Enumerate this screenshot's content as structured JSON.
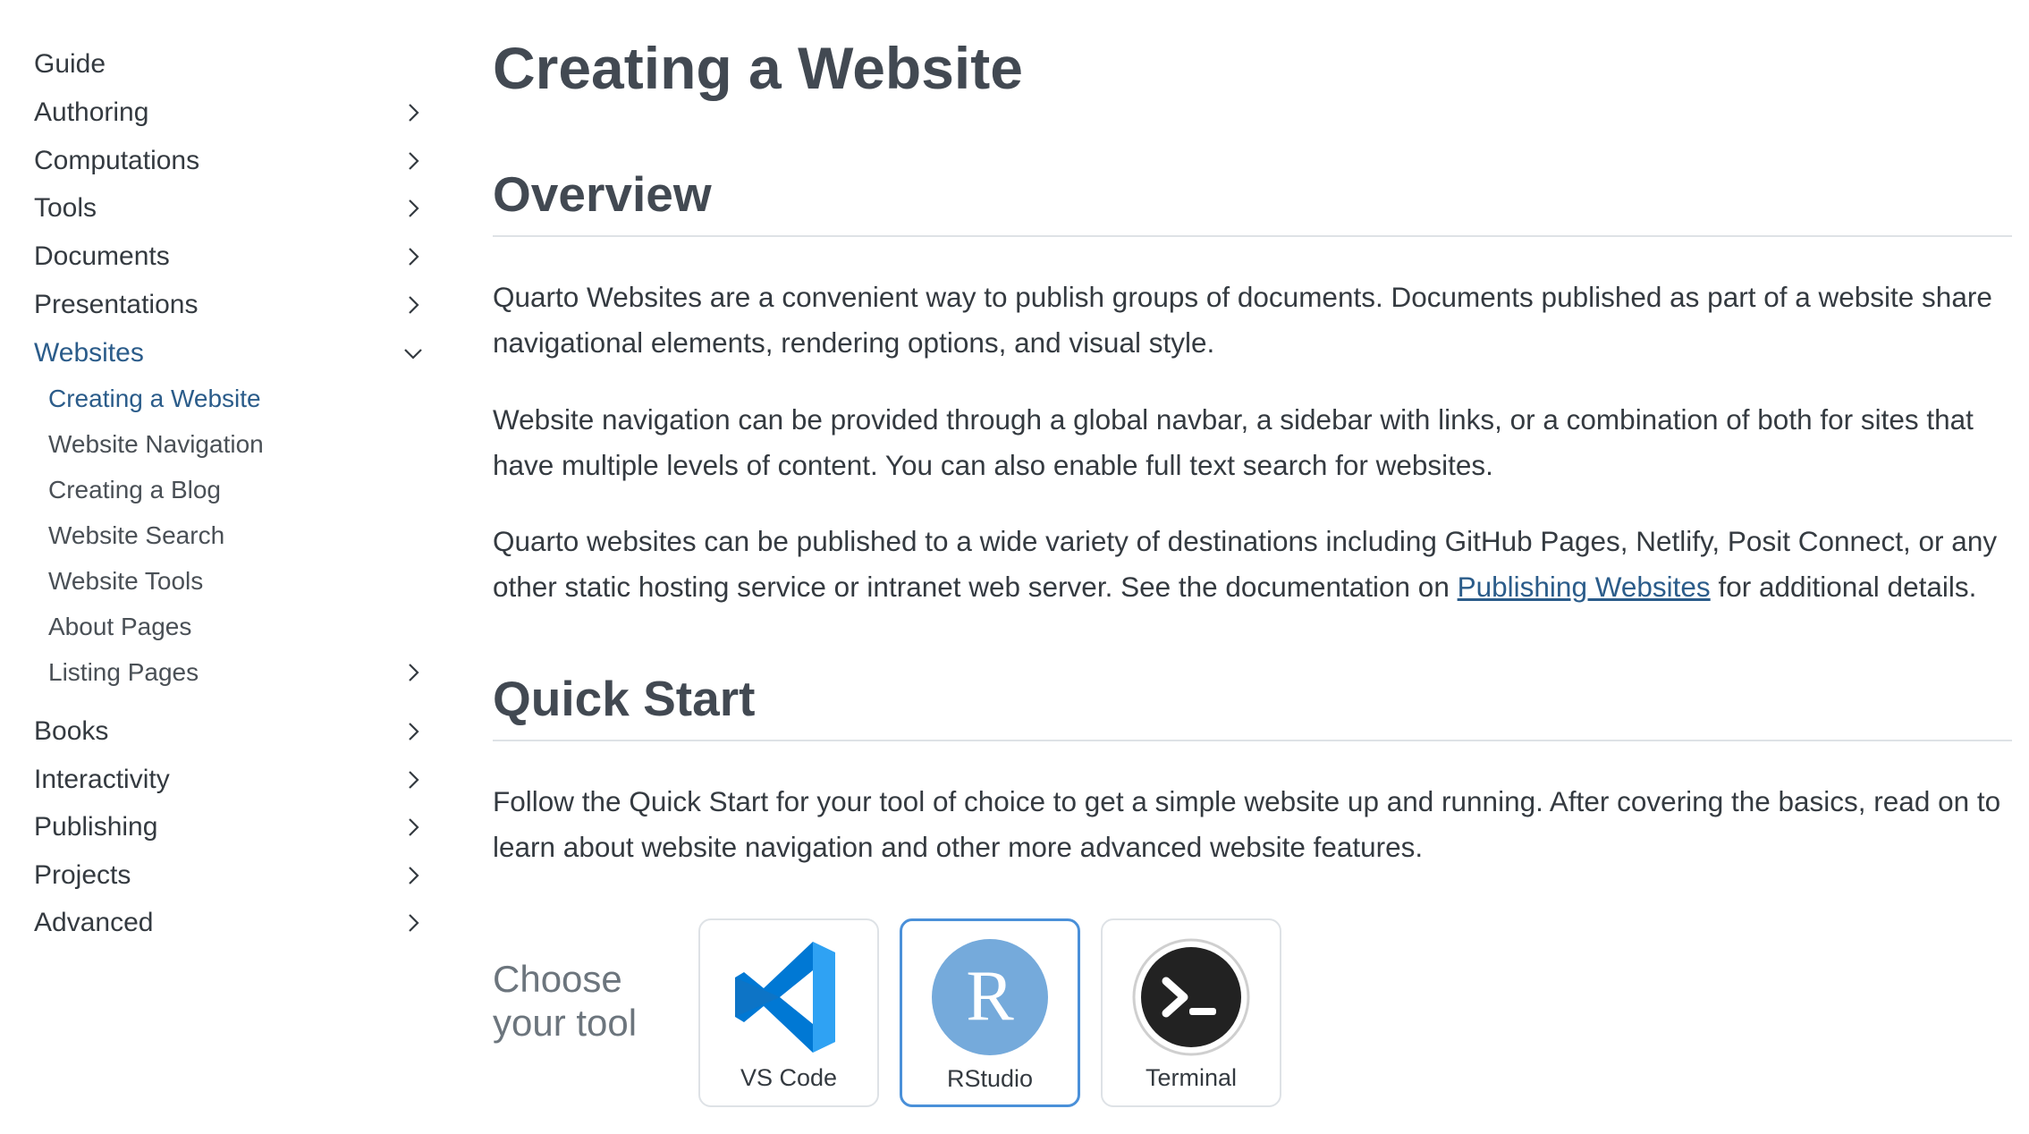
{
  "sidebar": {
    "items": [
      {
        "label": "Guide"
      },
      {
        "label": "Authoring"
      },
      {
        "label": "Computations"
      },
      {
        "label": "Tools"
      },
      {
        "label": "Documents"
      },
      {
        "label": "Presentations"
      },
      {
        "label": "Websites"
      },
      {
        "label": "Books"
      },
      {
        "label": "Interactivity"
      },
      {
        "label": "Publishing"
      },
      {
        "label": "Projects"
      },
      {
        "label": "Advanced"
      }
    ],
    "websites_sub": [
      {
        "label": "Creating a Website"
      },
      {
        "label": "Website Navigation"
      },
      {
        "label": "Creating a Blog"
      },
      {
        "label": "Website Search"
      },
      {
        "label": "Website Tools"
      },
      {
        "label": "About Pages"
      },
      {
        "label": "Listing Pages"
      }
    ]
  },
  "main": {
    "title": "Creating a Website",
    "overview": {
      "heading": "Overview",
      "p1": "Quarto Websites are a convenient way to publish groups of documents. Documents published as part of a website share navigational elements, rendering options, and visual style.",
      "p2": "Website navigation can be provided through a global navbar, a sidebar with links, or a combination of both for sites that have multiple levels of content. You can also enable full text search for websites.",
      "p3_before": "Quarto websites can be published to a wide variety of destinations including GitHub Pages, Netlify, Posit Connect, or any other static hosting service or intranet web server. See the documentation on ",
      "p3_link": "Publishing Websites",
      "p3_after": " for additional details."
    },
    "quickstart": {
      "heading": "Quick Start",
      "p1": "Follow the Quick Start for your tool of choice to get a simple website up and running. After covering the basics, read on to learn about website navigation and other more advanced website features."
    },
    "tool_chooser": {
      "prompt": "Choose your tool",
      "tools": [
        {
          "label": "VS Code",
          "icon": "vscode-icon"
        },
        {
          "label": "RStudio",
          "icon": "rstudio-icon",
          "icon_letter": "R",
          "selected": true
        },
        {
          "label": "Terminal",
          "icon": "terminal-icon"
        }
      ]
    }
  },
  "colors": {
    "link": "#2b5c8a",
    "heading": "#424952",
    "selected_border": "#4a90d9",
    "rstudio_blue": "#75aadb",
    "vscode_blue": "#0078d4"
  }
}
